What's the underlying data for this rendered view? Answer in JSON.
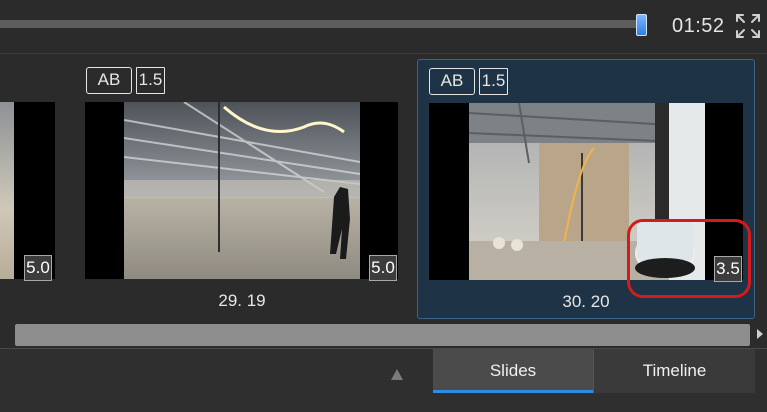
{
  "player": {
    "time": "01:52",
    "progress_fraction": 0.84,
    "fullscreen_icon": "fullscreen-icon"
  },
  "slides": [
    {
      "duration": "5.0"
    },
    {
      "badge_ab": "AB",
      "badge_value": "1.5",
      "duration": "5.0",
      "caption": "29. 19"
    },
    {
      "badge_ab": "AB",
      "badge_value": "1.5",
      "duration": "3.5",
      "caption": "30. 20",
      "selected": true
    }
  ],
  "tabs": {
    "slides": "Slides",
    "timeline": "Timeline"
  },
  "colors": {
    "accent": "#2f8be6",
    "selected_bg": "#1f3347",
    "annotation": "#d41a1a"
  }
}
